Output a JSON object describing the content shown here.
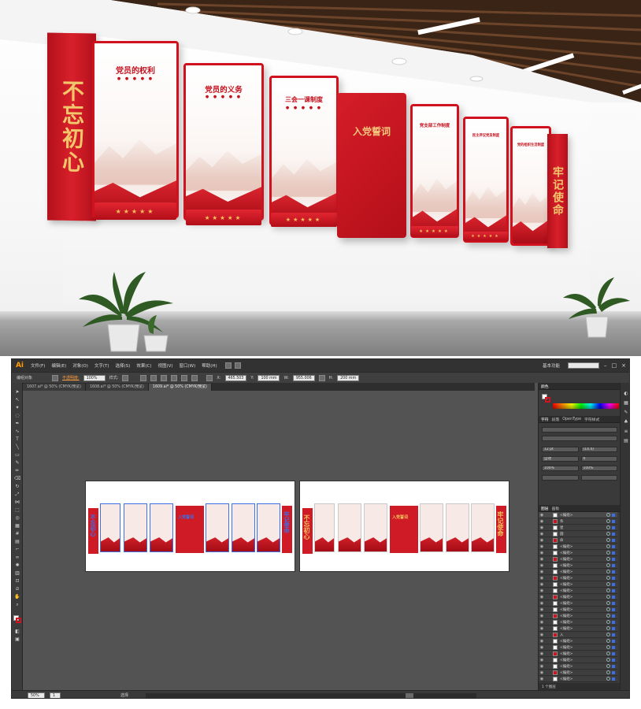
{
  "showroom": {
    "left_banner": "不忘初心",
    "right_banner": "牢记使命",
    "boards": [
      {
        "title": "党员的权利"
      },
      {
        "title": "党员的义务"
      },
      {
        "title": "三会一课制度"
      },
      {
        "title": "党支部工作制度"
      },
      {
        "title": "民主评议党员制度"
      },
      {
        "title": "党的组织生活制度"
      }
    ],
    "center_title": "入党誓词",
    "stars": "★★★★★",
    "dots": "● ● ● ● ●"
  },
  "illustrator": {
    "app_logo": "Ai",
    "menu": [
      "文件(F)",
      "编辑(E)",
      "对象(O)",
      "文字(T)",
      "选择(S)",
      "效果(C)",
      "视图(V)",
      "窗口(W)",
      "帮助(H)"
    ],
    "workspace": "基本功能",
    "control": {
      "object_label": "编组对象",
      "opacity_label": "不透明度:",
      "opacity_value": "100%",
      "style_label": "样式:",
      "x_value": "465.503",
      "y_value": "100 mm",
      "w_value": "955.006",
      "h_value": "200 mm"
    },
    "tabs": [
      {
        "label": "1607.ai* @ 50% (CMYK/预览)"
      },
      {
        "label": "1608.ai* @ 50% (CMYK/预览)"
      },
      {
        "label": "1609.ai* @ 50% (CMYK/预览)"
      }
    ],
    "artboard_left": {
      "vertical_left": "不忘初心",
      "vertical_right": "牢记使命",
      "center": "入党誓词"
    },
    "artboard_right": {
      "vertical_left": "不忘初心",
      "vertical_right": "牢记使命",
      "center": "入党誓词"
    },
    "color_panel": {
      "tabs": [
        "颜色"
      ],
      "fill": "#ffffff",
      "stroke": "#d1111d"
    },
    "character_panel": {
      "tabs": [
        "字符",
        "段落",
        "OpenType",
        "字符样式"
      ],
      "font_size": "12 pt",
      "leading": "(14.4)",
      "tracking": "0",
      "scale_h": "100%",
      "scale_v": "100%",
      "kerning": "自动"
    },
    "layers_panel": {
      "tabs": [
        "图层",
        "画板"
      ],
      "footer": "1 个图层",
      "rows": [
        {
          "name": "<编组>",
          "parent": true
        },
        {
          "name": "条",
          "parent": false
        },
        {
          "name": "星",
          "parent": false
        },
        {
          "name": "圆",
          "parent": false
        },
        {
          "name": "命",
          "parent": false
        },
        {
          "name": "<编组>",
          "parent": false
        },
        {
          "name": "<编组>",
          "parent": false
        },
        {
          "name": "<编组>",
          "parent": false
        },
        {
          "name": "<编组>",
          "parent": false
        },
        {
          "name": "<编组>",
          "parent": false
        },
        {
          "name": "<编组>",
          "parent": false
        },
        {
          "name": "<编组>",
          "parent": false
        },
        {
          "name": "<编组>",
          "parent": false
        },
        {
          "name": "<编组>",
          "parent": false
        },
        {
          "name": "<编组>",
          "parent": false
        },
        {
          "name": "<编组>",
          "parent": false
        },
        {
          "name": "<编组>",
          "parent": false
        },
        {
          "name": "<编组>",
          "parent": false
        },
        {
          "name": "<编组>",
          "parent": false
        },
        {
          "name": "入",
          "parent": false
        },
        {
          "name": "<编组>",
          "parent": false
        },
        {
          "name": "<编组>",
          "parent": false
        },
        {
          "name": "<编组>",
          "parent": false
        },
        {
          "name": "<编组>",
          "parent": false
        },
        {
          "name": "<编组>",
          "parent": false
        },
        {
          "name": "<编组>",
          "parent": false
        },
        {
          "name": "<编组>",
          "parent": false
        }
      ]
    },
    "status": {
      "zoom": "50%",
      "page": "1",
      "mode": "选择"
    }
  }
}
